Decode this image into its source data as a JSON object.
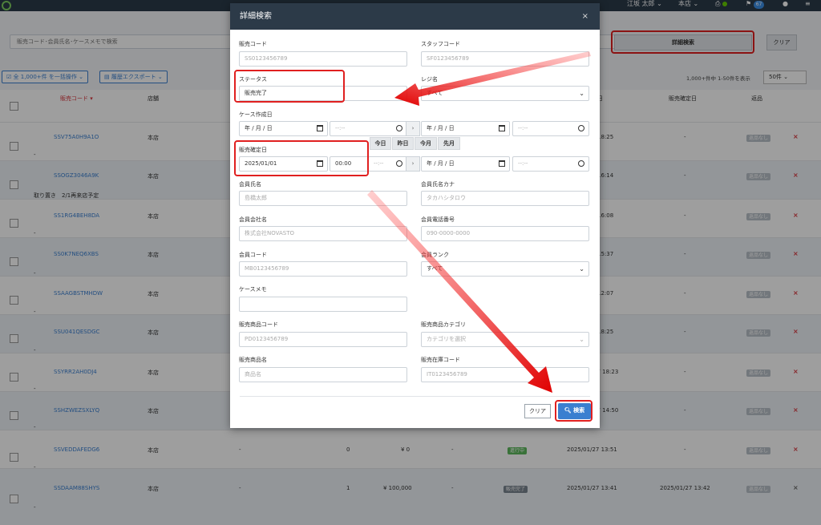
{
  "topbar": {
    "user": "江坂 太郎",
    "store": "本店",
    "badge": "67"
  },
  "search": {
    "placeholder": "販売コード･会員氏名･ケースメモで検索",
    "advanced_label": "詳細検索",
    "clear_label": "クリア"
  },
  "toolbar": {
    "bulk_label": "全 1,000+件 を一括操作",
    "export_label": "履歴エクスポート",
    "count_text": "1,000+件中 1-50件を表示",
    "per_page": "50件"
  },
  "table": {
    "headers": [
      "販売コード",
      "店舗",
      "日",
      "販売確定日",
      "返品"
    ],
    "rows": [
      {
        "code": "SSV75A0H9A1O",
        "store": "本店",
        "date": "18:25",
        "confirmed": "-",
        "return": "返品なし",
        "memo": "-",
        "qty": "",
        "amount": "",
        "status": ""
      },
      {
        "code": "SSOGZ3046A9K",
        "store": "本店",
        "date": "16:14",
        "confirmed": "-",
        "return": "返品なし",
        "memo": "取り置き　2/1再来店予定",
        "qty": "",
        "amount": "",
        "status": ""
      },
      {
        "code": "SS1RG4BEH8DA",
        "store": "本店",
        "date": "16:08",
        "confirmed": "-",
        "return": "返品なし",
        "memo": "-",
        "qty": "",
        "amount": "",
        "status": ""
      },
      {
        "code": "SS0K7NEQ6XBS",
        "store": "本店",
        "date": "15:37",
        "confirmed": "-",
        "return": "返品なし",
        "memo": "-",
        "qty": "",
        "amount": "",
        "status": ""
      },
      {
        "code": "SSAAGBSTMHDW",
        "store": "本店",
        "date": "12:07",
        "confirmed": "-",
        "return": "返品なし",
        "memo": "-",
        "qty": "",
        "amount": "",
        "status": ""
      },
      {
        "code": "SSU041QESDGC",
        "store": "本店",
        "date": "18:25",
        "confirmed": "-",
        "return": "返品なし",
        "memo": "-",
        "qty": "",
        "amount": "",
        "status": ""
      },
      {
        "code": "SSYRR2AH0DJ4",
        "store": "本店",
        "date": "27 18:23",
        "confirmed": "-",
        "return": "返品なし",
        "memo": "-",
        "qty": "",
        "amount": "",
        "status": ""
      },
      {
        "code": "SSHZWEZSXLYQ",
        "store": "本店",
        "date": "27 14:50",
        "confirmed": "-",
        "return": "返品なし",
        "memo": "-",
        "qty": "",
        "amount": "",
        "status": ""
      },
      {
        "code": "SSVEDDAFEDG6",
        "store": "本店",
        "date": "2025/01/27 13:51",
        "confirmed": "-",
        "return": "返品なし",
        "memo": "-",
        "qty": "0",
        "amount": "¥ 0",
        "status": "進行中",
        "dash": "-"
      },
      {
        "code": "SSDAAM88SHYS",
        "store": "本店",
        "date": "2025/01/27 13:41",
        "confirmed": "2025/01/27 13:42",
        "return": "返品なし",
        "memo": "-",
        "qty": "1",
        "amount": "¥ 100,000",
        "status": "販売完了",
        "dash": "-"
      }
    ]
  },
  "modal": {
    "title": "詳細検索",
    "close": "×",
    "sales_code": {
      "label": "販売コード",
      "placeholder": "SS0123456789"
    },
    "staff_code": {
      "label": "スタッフコード",
      "placeholder": "SF0123456789"
    },
    "status": {
      "label": "ステータス",
      "value": "販売完了"
    },
    "register": {
      "label": "レジ名",
      "value": "すべて"
    },
    "case_created": {
      "label": "ケース作成日",
      "date": "年 / 月 / 日",
      "time": "--:--",
      "sep": "›"
    },
    "quick_dates": [
      "今日",
      "昨日",
      "今月",
      "先月"
    ],
    "sales_confirmed": {
      "label": "販売確定日",
      "date": "2025/01/01",
      "time": "00:00",
      "end_date": "年 / 月 / 日",
      "end_time": "--:--",
      "empty_time": "--:--"
    },
    "member_name": {
      "label": "会員氏名",
      "placeholder": "島橋太郎"
    },
    "member_kana": {
      "label": "会員氏名カナ",
      "placeholder": "タカハシタロウ"
    },
    "member_company": {
      "label": "会員会社名",
      "placeholder": "株式会社NOVASTO"
    },
    "member_phone": {
      "label": "会員電話番号",
      "placeholder": "090-0000-0000"
    },
    "member_code": {
      "label": "会員コード",
      "placeholder": "MB0123456789"
    },
    "member_rank": {
      "label": "会員ランク",
      "value": "すべて"
    },
    "case_memo": {
      "label": "ケースメモ",
      "placeholder": ""
    },
    "product_code": {
      "label": "販売商品コード",
      "placeholder": "PD0123456789"
    },
    "product_category": {
      "label": "販売商品カテゴリ",
      "placeholder": "カテゴリを選択"
    },
    "product_name": {
      "label": "販売商品名",
      "placeholder": "商品名"
    },
    "stock_code": {
      "label": "販売在庫コード",
      "placeholder": "IT0123456789"
    },
    "clear_label": "クリア",
    "search_label": "検索"
  },
  "colors": {
    "accent": "#3a7fd0",
    "annotation": "#e02020",
    "header": "#2c3a48"
  }
}
